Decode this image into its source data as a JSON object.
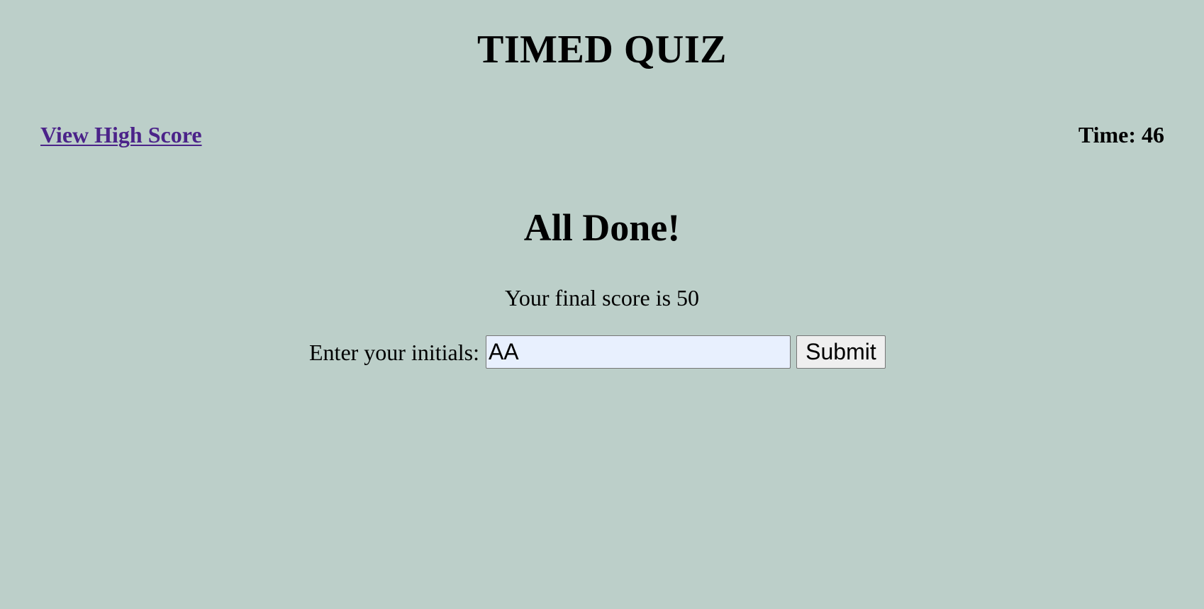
{
  "header": {
    "title": "TIMED QUIZ",
    "high_score_link": "View High Score",
    "timer": {
      "label": "Time:",
      "value": "46"
    }
  },
  "main": {
    "heading": "All Done!",
    "score_text": "Your final score is",
    "score_value": "50",
    "initials_label": "Enter your initials:",
    "initials_value": "AA",
    "submit_label": "Submit"
  },
  "colors": {
    "background": "#bccfc9",
    "link": "#4b2389",
    "input_autofill": "#e8f0fe"
  }
}
